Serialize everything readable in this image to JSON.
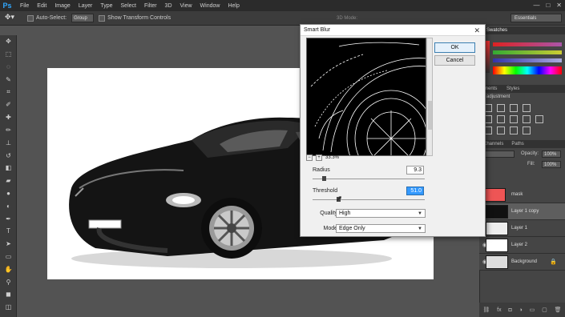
{
  "menubar": {
    "logo": "Ps",
    "items": [
      "File",
      "Edit",
      "Image",
      "Layer",
      "Type",
      "Select",
      "Filter",
      "3D",
      "View",
      "Window",
      "Help"
    ],
    "window_controls": [
      "—",
      "□",
      "✕"
    ]
  },
  "optionsbar": {
    "auto_select_label": "Auto-Select:",
    "auto_select_value": "Group",
    "transform_label": "Show Transform Controls",
    "mode_3d": "3D Mode:",
    "workspace": "Essentials"
  },
  "dialog": {
    "title": "Smart Blur",
    "close": "✕",
    "ok_label": "OK",
    "cancel_label": "Cancel",
    "zoom_minus": "−",
    "zoom_plus": "+",
    "zoom_level": "33.3%",
    "radius_label": "Radius",
    "radius_value": "9.3",
    "threshold_label": "Threshold",
    "threshold_value": "51.0",
    "quality_label": "Quality:",
    "quality_value": "High",
    "mode_label": "Mode:",
    "mode_value": "Edge Only"
  },
  "panels": {
    "swatches_tab": "Swatches",
    "adjustments_tab": "ments",
    "styles_tab": "Styles",
    "add_adjustment": "n adjustment",
    "channels_tab": "Channels",
    "paths_tab": "Paths",
    "opacity_label": "Opacity:",
    "opacity_value": "100%",
    "fill_label": "Fill:",
    "fill_value": "100%",
    "layers": [
      {
        "name": "mask",
        "selected": false
      },
      {
        "name": "Layer 1 copy",
        "selected": true
      },
      {
        "name": "Layer 1",
        "selected": false
      },
      {
        "name": "Layer 2",
        "selected": false
      },
      {
        "name": "Background",
        "selected": false
      }
    ]
  }
}
